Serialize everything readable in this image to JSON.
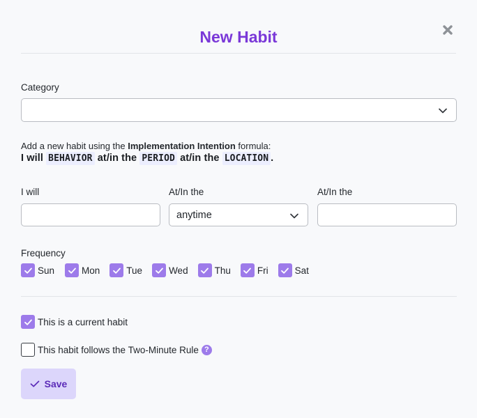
{
  "modal": {
    "title": "New Habit"
  },
  "category": {
    "label": "Category",
    "value": ""
  },
  "intro": {
    "prefix": "Add a new habit using the ",
    "bold": "Implementation Intention",
    "suffix": " formula:"
  },
  "formula": {
    "i_will": "I will",
    "behavior": "BEHAVIOR",
    "at_in_1": "at/in the",
    "period": "PERIOD",
    "at_in_2": "at/in the",
    "location": "LOCATION",
    "end": "."
  },
  "fields": {
    "behavior_label": "I will",
    "behavior_value": "",
    "period_label": "At/In the",
    "period_value": "anytime",
    "location_label": "At/In the",
    "location_value": ""
  },
  "frequency": {
    "label": "Frequency",
    "days": [
      {
        "label": "Sun",
        "checked": true
      },
      {
        "label": "Mon",
        "checked": true
      },
      {
        "label": "Tue",
        "checked": true
      },
      {
        "label": "Wed",
        "checked": true
      },
      {
        "label": "Thu",
        "checked": true
      },
      {
        "label": "Fri",
        "checked": true
      },
      {
        "label": "Sat",
        "checked": true
      }
    ]
  },
  "options": {
    "current_habit_label": "This is a current habit",
    "current_habit_checked": true,
    "two_minute_label": "This habit follows the Two-Minute Rule",
    "two_minute_checked": false,
    "help_glyph": "?"
  },
  "save": {
    "label": "Save"
  },
  "colors": {
    "accent": "#7a38d8",
    "checkbox": "#9d7bea",
    "save_bg": "#dcd6fb"
  },
  "icons": {
    "close": "close-icon",
    "chevron": "chevron-down-icon",
    "check": "check-icon",
    "help": "question-icon"
  }
}
